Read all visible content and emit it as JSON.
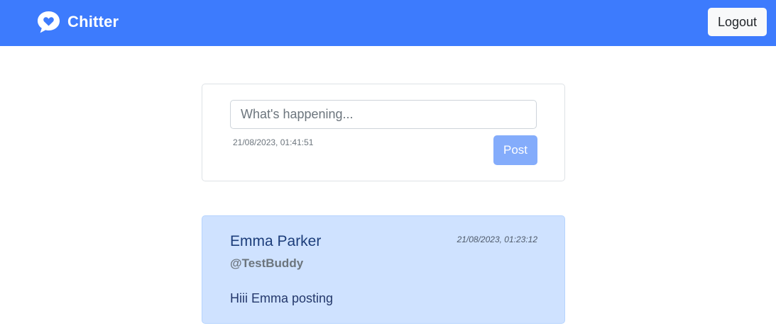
{
  "navbar": {
    "brand_name": "Chitter",
    "brand_icon": "chat-bubble-heart-icon",
    "logout_label": "Logout",
    "background_color": "#3d7bfd"
  },
  "compose": {
    "placeholder": "What's happening...",
    "value": "",
    "timestamp": "21/08/2023, 01:41:51",
    "post_label": "Post"
  },
  "peeps": [
    {
      "name": "Emma Parker",
      "handle": "@TestBuddy",
      "timestamp": "21/08/2023, 01:23:12",
      "content": "Hiii Emma posting"
    }
  ]
}
